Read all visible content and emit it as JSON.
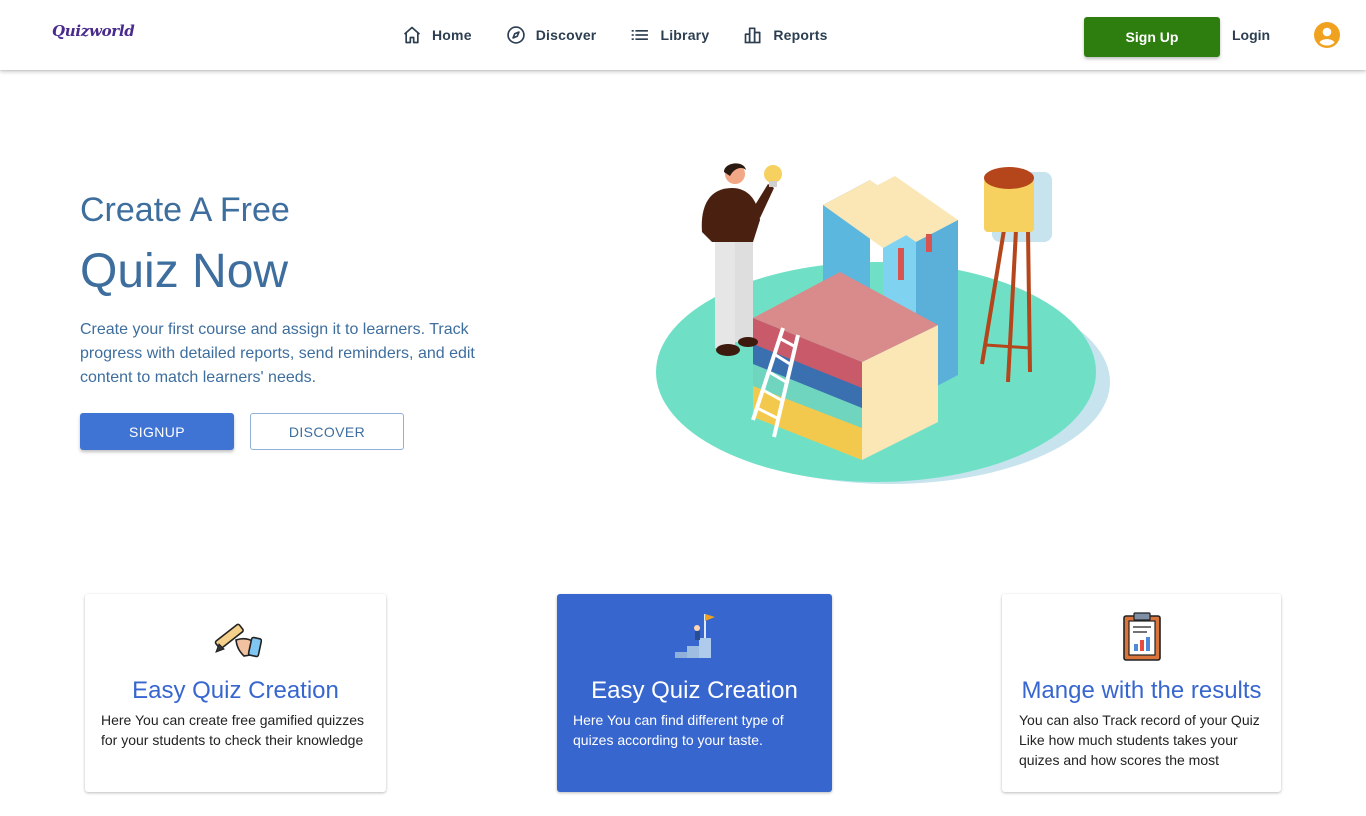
{
  "header": {
    "logo": "Quizworld",
    "nav": [
      {
        "label": "Home",
        "icon": "home-icon"
      },
      {
        "label": "Discover",
        "icon": "compass-icon"
      },
      {
        "label": "Library",
        "icon": "list-icon"
      },
      {
        "label": "Reports",
        "icon": "bar-chart-icon"
      }
    ],
    "signup_label": "Sign Up",
    "login_label": "Login",
    "avatar_icon": "user-circle-icon"
  },
  "hero": {
    "title_line1": "Create A Free",
    "title_line2": "Quiz Now",
    "description": "Create your first course and assign it to learners. Track progress with detailed reports, send reminders, and edit content to match learners' needs.",
    "signup_label": "SIGNUP",
    "discover_label": "DISCOVER",
    "illustration_icon": "books-illustration"
  },
  "cards": [
    {
      "title": "Easy Quiz Creation",
      "body": "Here You can create free gamified quizzes for your students to check their knowledge",
      "icon": "pencil-hand-icon"
    },
    {
      "title": "Easy Quiz Creation",
      "body": "Here You can find different type of quizes according to your taste.",
      "icon": "stairs-flag-icon"
    },
    {
      "title": "Mange with the results",
      "body": "You can also Track record of your Quiz Like how much students takes your quizes and how scores the most",
      "icon": "clipboard-chart-icon"
    }
  ],
  "colors": {
    "primary_blue": "#3f74d4",
    "card_blue": "#3866cf",
    "signup_green": "#2e7d0f",
    "hero_text": "#3e6e9e",
    "avatar_orange": "#f0a21f"
  }
}
